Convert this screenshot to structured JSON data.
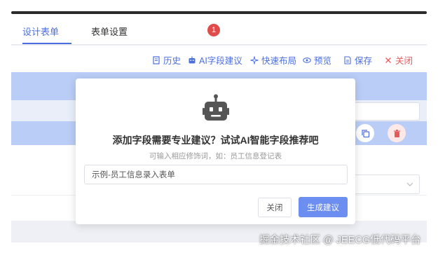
{
  "tabs": [
    {
      "label": "设计表单",
      "active": true
    },
    {
      "label": "表单设置",
      "active": false
    }
  ],
  "toolbar": {
    "history": {
      "label": "历史",
      "icon": "history-doc-icon"
    },
    "ai_suggest": {
      "label": "AI字段建议",
      "icon": "robot-icon"
    },
    "quick_layout": {
      "label": "快速布局",
      "icon": "sparkle-icon"
    },
    "preview": {
      "label": "预览",
      "icon": "eye-icon"
    },
    "save": {
      "label": "保存",
      "icon": "save-doc-icon"
    },
    "close": {
      "label": "关闭",
      "icon": "close-icon"
    }
  },
  "badge": {
    "count": "1",
    "color": "#e04c4c"
  },
  "popup": {
    "icon": "robot-icon",
    "title": "添加字段需要专业建议？试试AI智能字段推荐吧",
    "hint": "可输入相应修饰词，如：员工信息登记表",
    "input_value": "示例-员工信息录入表单",
    "close_label": "关闭",
    "generate_label": "生成建议"
  },
  "watermark": "掘金技术社区 @ JEECG低代码平台",
  "colors": {
    "accent": "#4b6fe0",
    "danger": "#e55b5b",
    "primary_button": "#6b8ef0",
    "highlight": "#b9cdf7"
  }
}
